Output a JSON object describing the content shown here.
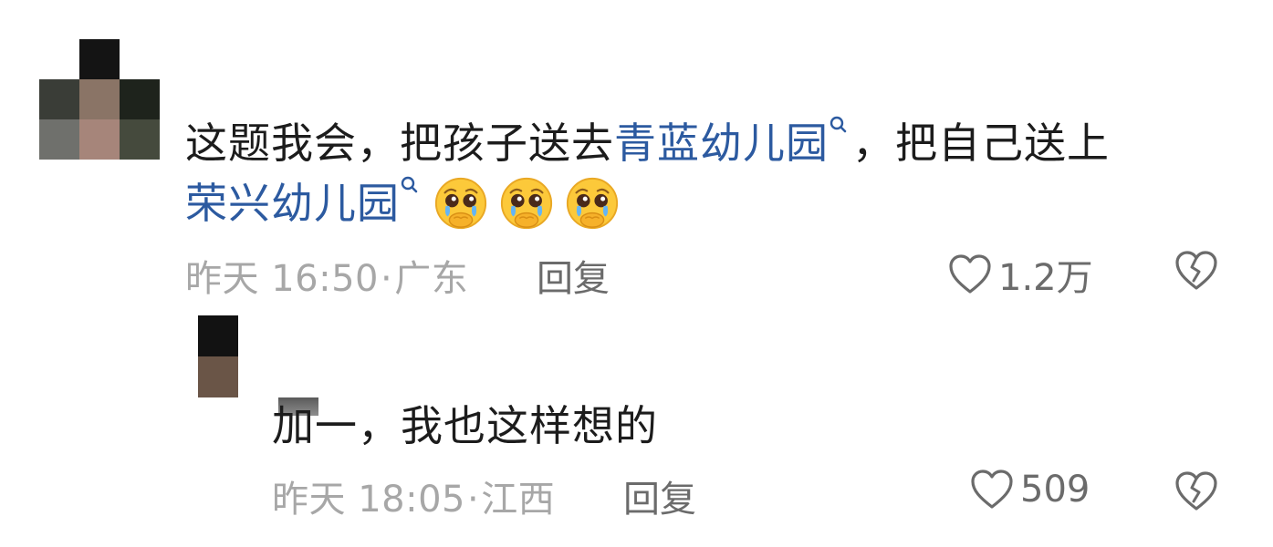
{
  "comment": {
    "text_before_link1": "这题我会，把孩子送去",
    "link1": "青蓝幼儿园",
    "text_between_links": "，把自己送上",
    "link2": "荣兴幼儿园",
    "emoji_name": "pleading-face-holding-back-tears",
    "time": "昨天 16:50",
    "location": "广东",
    "reply_label": "回复",
    "like_count": "1.2万"
  },
  "reply": {
    "text": "加一，我也这样想的",
    "time": "昨天 18:05",
    "location": "江西",
    "reply_label": "回复",
    "like_count": "509"
  },
  "separator": "·",
  "colors": {
    "text": "#1c1c1c",
    "link": "#2c5aa0",
    "meta": "#a7a7a7",
    "action": "#6b6b6b"
  },
  "icons": {
    "like": "heart-outline-icon",
    "dislike": "broken-heart-icon",
    "link_search": "search-icon",
    "emoji": "pleading-face-emoji-icon"
  }
}
